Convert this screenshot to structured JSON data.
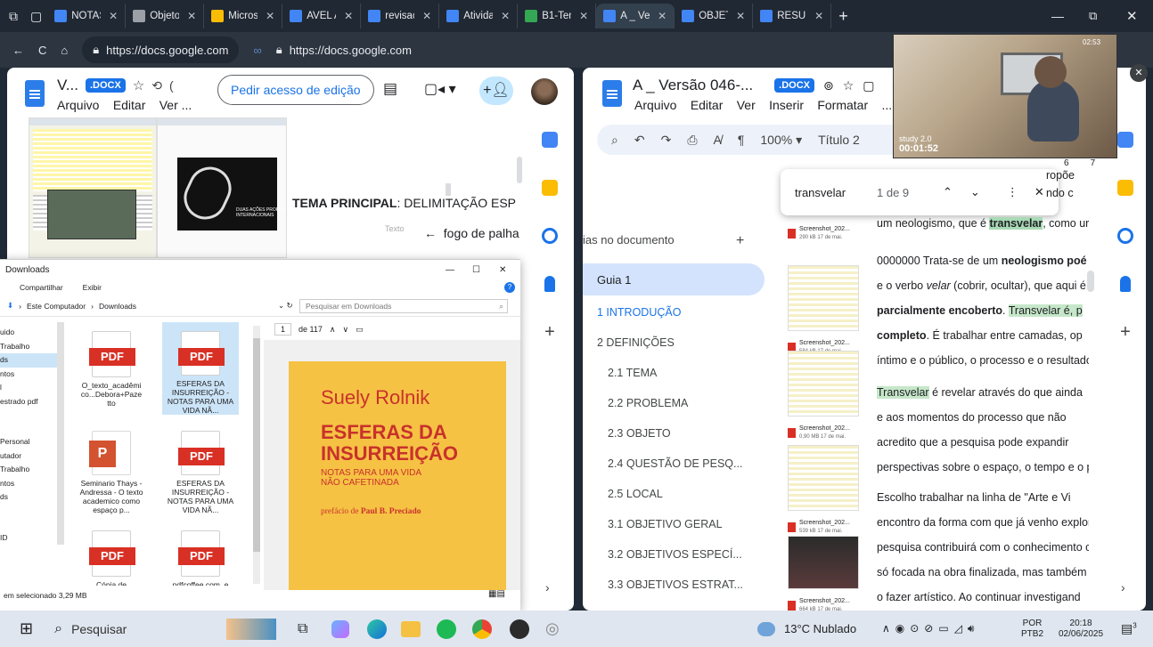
{
  "tabs": [
    {
      "label": "NOTAS",
      "color": "#4285f4"
    },
    {
      "label": "Objeto",
      "color": "#9aa0a6"
    },
    {
      "label": "Micros",
      "color": "#fbbc04"
    },
    {
      "label": "AVEL A",
      "color": "#4285f4"
    },
    {
      "label": "revisac",
      "color": "#4285f4"
    },
    {
      "label": "Ativida",
      "color": "#4285f4"
    },
    {
      "label": "B1-Ten",
      "color": "#34a853"
    },
    {
      "label": "A _ Ver",
      "color": "#4285f4"
    },
    {
      "label": "OBJETO",
      "color": "#4285f4"
    },
    {
      "label": "RESUM",
      "color": "#4285f4"
    }
  ],
  "address": {
    "url1": "https://docs.google.com",
    "url2": "https://docs.google.com"
  },
  "left_doc": {
    "title": "V...",
    "badge": ".DOCX",
    "menu": [
      "Arquivo",
      "Editar",
      "Ver ..."
    ],
    "request_button": "Pedir acesso de edição",
    "tema_label": "TEMA PRINCIPAL",
    "tema_text": ": DELIMITAÇÃO ESP",
    "texto_label": "Texto",
    "fogo": "fogo de palha",
    "slide_panel_title": "DUAS AÇÕES PROPOSTAS\nINTERNACIONAIS"
  },
  "explorer": {
    "title": "Downloads",
    "ribbon": [
      "Compartilhar",
      "Exibir"
    ],
    "breadcrumb": [
      "Este Computador",
      "Downloads"
    ],
    "search_placeholder": "Pesquisar em Downloads",
    "nav_items": [
      "uido",
      "Trabalho",
      "ds",
      "ntos",
      "l",
      "estrado pdf",
      "Personal",
      "utador",
      "Trabalho",
      "ntos",
      "ds",
      "ID"
    ],
    "files": [
      {
        "name": "O_texto_acadêmi co...Debora+Paze tto",
        "type": "pdf"
      },
      {
        "name": "ESFERAS DA INSURREIÇÃO - NOTAS PARA UMA VIDA NÃ...",
        "type": "pdf"
      },
      {
        "name": "Seminario Thays - Andressa - O texto academico como espaço p...",
        "type": "ppt"
      },
      {
        "name": "ESFERAS DA INSURREIÇÃO - NOTAS PARA UMA VIDA NÃ...",
        "type": "pdf"
      },
      {
        "name": "Cópia de FERREIRA, Carolin O...",
        "type": "pdf"
      },
      {
        "name": "pdfcoffee.com_e dmond-couchot vda-fotografia-a...",
        "type": "pdf"
      }
    ],
    "status": "em selecionado  3,29 MB",
    "pdf_icon_label": "PDF",
    "preview": {
      "page": "1",
      "page_of": "de 117",
      "author": "Suely Rolnik",
      "book_title_1": "ESFERAS DA",
      "book_title_2": "INSURREIÇÃO",
      "subtitle_1": "NOTAS PARA UMA VIDA",
      "subtitle_2": "NÃO CAFETINADA",
      "preface_prefix": "prefácio de",
      "preface_name": "Paul B. Preciado"
    }
  },
  "right_doc": {
    "title": "A _ Versão 046-...",
    "badge": ".DOCX",
    "menu": [
      "Arquivo",
      "Editar",
      "Ver",
      "Inserir",
      "Formatar",
      "..."
    ],
    "zoom": "100%",
    "style": "Título 2",
    "find": {
      "query": "transvelar",
      "count": "1 de 9"
    },
    "outline_header": "ias no documento",
    "outline": [
      {
        "label": "Guia 1",
        "active": true
      },
      {
        "label": "1 INTRODUÇÃO",
        "link": true
      },
      {
        "label": "2 DEFINIÇÕES"
      },
      {
        "label": "2.1 TEMA"
      },
      {
        "label": "2.2 PROBLEMA"
      },
      {
        "label": "2.3 OBJETO"
      },
      {
        "label": "2.4 QUESTÃO DE PESQ..."
      },
      {
        "label": "2.5 LOCAL"
      },
      {
        "label": "3.1 OBJETIVO GERAL"
      },
      {
        "label": "3.2 OBJETIVOS ESPECÍ..."
      },
      {
        "label": "3.3 OBJETIVOS ESTRAT..."
      }
    ],
    "screenshots": [
      {
        "name": "Screenshot_202...",
        "meta": "290 kB 17 de mai."
      },
      {
        "name": "Screenshot_202...",
        "meta": "584 kB 17 de mai."
      },
      {
        "name": "Screenshot_202...",
        "meta": "0,90 MB 17 de mai."
      },
      {
        "name": "Screenshot_202...",
        "meta": "539 kB 17 de mai."
      },
      {
        "name": "Screenshot_202...",
        "meta": "664 kB 17 de mai."
      }
    ],
    "body_lines": [
      {
        "pre": "",
        "b": "",
        "mid": "",
        "tail": "ropõe"
      },
      {
        "pre": "",
        "b": "",
        "mid": "",
        "tail": "ndo c"
      },
      {
        "pre": "um neologismo, que é ",
        "b": "transvelar",
        "mid": "",
        "tail": ", como ur"
      },
      {
        "pre": "0000000 Trata-se de um ",
        "b": "neologismo poé",
        "mid": "",
        "tail": ""
      },
      {
        "pre": "e o verbo ",
        "b": "",
        "mid": "velar",
        "tail": " (cobrir, ocultar), que aqui é"
      },
      {
        "pre": "",
        "b": "parcialmente encoberto",
        "mid": ". ",
        "tail": "Transvelar é, p"
      },
      {
        "pre": "",
        "b": "completo",
        "mid": "",
        "tail": ". É trabalhar entre camadas, op"
      },
      {
        "pre": "íntimo e o público, o processo e o resultado",
        "b": "",
        "mid": "",
        "tail": ""
      },
      {
        "pre": "Transvelar",
        "b": "",
        "mid": "",
        "tail": " é revelar através do que ainda"
      },
      {
        "pre": "e aos momentos do processo que não",
        "b": "",
        "mid": "",
        "tail": ""
      },
      {
        "pre": "acredito que a pesquisa pode expandir",
        "b": "",
        "mid": "",
        "tail": ""
      },
      {
        "pre": "perspectivas sobre o espaço, o tempo e o p",
        "b": "",
        "mid": "",
        "tail": ""
      },
      {
        "pre": "Escolho trabalhar na linha de \"Arte e Vi",
        "b": "",
        "mid": "",
        "tail": ""
      },
      {
        "pre": "encontro da forma com que já venho explor",
        "b": "",
        "mid": "",
        "tail": ""
      },
      {
        "pre": "pesquisa contribuirá com o conhecimento c",
        "b": "",
        "mid": "",
        "tail": ""
      },
      {
        "pre": "só focada na obra finalizada, mas também",
        "b": "",
        "mid": "",
        "tail": ""
      },
      {
        "pre": "o fazer artístico. Ao continuar investigand",
        "b": "",
        "mid": "",
        "tail": ""
      }
    ],
    "ruler": [
      "6",
      "7"
    ]
  },
  "video_overlay": {
    "timer1": "00:01:52",
    "label": "study 2.0",
    "timer2": "02:53"
  },
  "taskbar": {
    "search": "Pesquisar",
    "weather": "13°C  Nublado",
    "lang1": "POR",
    "lang2": "PTB2",
    "time": "20:18",
    "date": "02/06/2025",
    "notif": "3"
  },
  "colors": {
    "accent": "#1a73e8",
    "book_bg": "#f6c244",
    "book_red": "#c8322b",
    "pdf_red": "#d93025"
  }
}
